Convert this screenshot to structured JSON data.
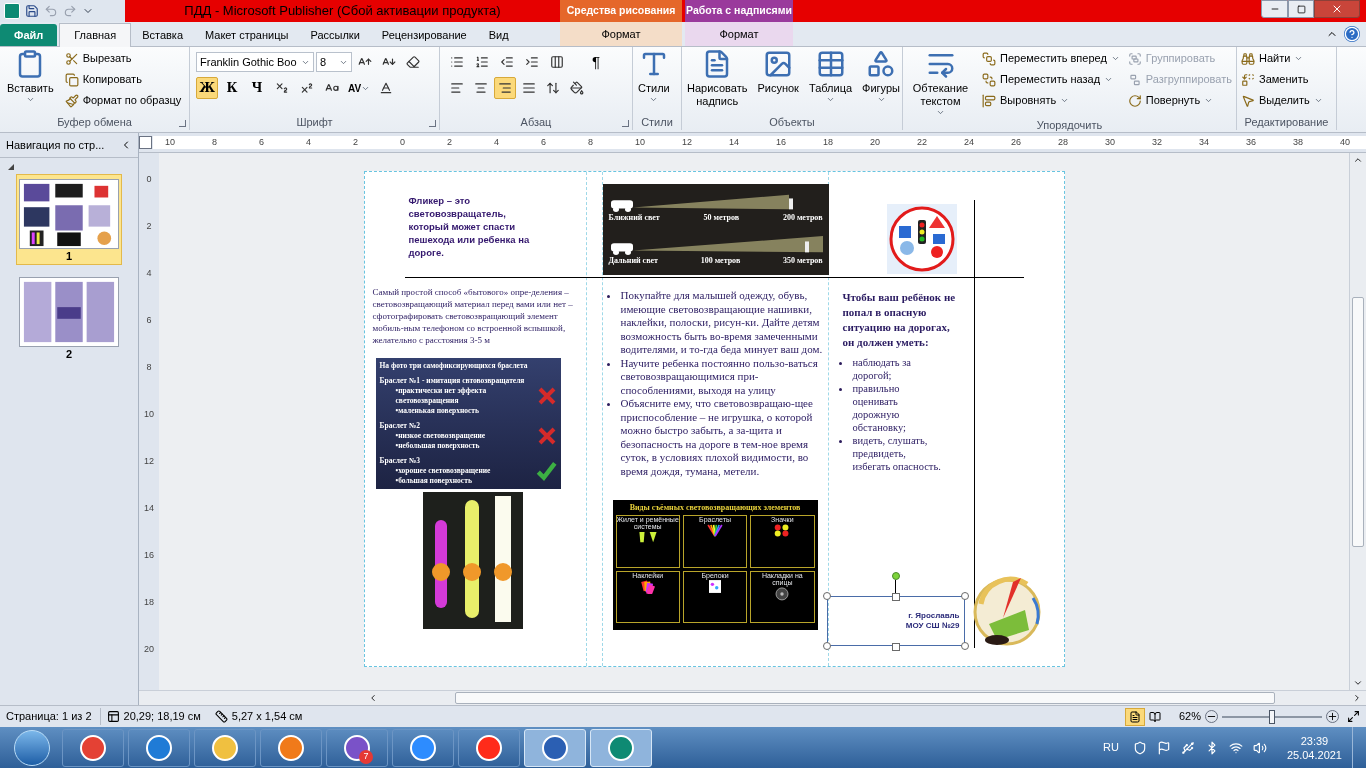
{
  "window": {
    "title": "ПДД  -  Microsoft Publisher (Сбой активации продукта)"
  },
  "contextual": [
    {
      "group": "Средства рисования",
      "tab": "Формат",
      "color": "#e5672a"
    },
    {
      "group": "Работа с надписями",
      "tab": "Формат",
      "color": "#9a3a9c"
    }
  ],
  "tabs": [
    {
      "label": "Файл",
      "kind": "file",
      "selected": false
    },
    {
      "label": "Главная",
      "kind": "normal",
      "selected": true
    },
    {
      "label": "Вставка",
      "kind": "normal",
      "selected": false
    },
    {
      "label": "Макет страницы",
      "kind": "normal",
      "selected": false
    },
    {
      "label": "Рассылки",
      "kind": "normal",
      "selected": false
    },
    {
      "label": "Рецензирование",
      "kind": "normal",
      "selected": false
    },
    {
      "label": "Вид",
      "kind": "normal",
      "selected": false
    }
  ],
  "ribbon": [
    {
      "kind": "clipboard",
      "label": "Буфер обмена",
      "launcher": true,
      "big": [
        {
          "label": "Вставить",
          "dropdown": true
        }
      ],
      "small": [
        {
          "label": "Вырезать",
          "dropdown": false,
          "disabled": false
        },
        {
          "label": "Копировать",
          "dropdown": false,
          "disabled": false
        },
        {
          "label": "Формат по образцу",
          "dropdown": false,
          "disabled": false
        }
      ]
    },
    {
      "kind": "font",
      "label": "Шрифт",
      "launcher": true,
      "font": "Franklin Gothic Boo",
      "size": "8",
      "format_buttons": [
        {
          "label": "Ж",
          "selected": true
        },
        {
          "label": "К",
          "selected": false
        },
        {
          "label": "Ч",
          "selected": false
        }
      ],
      "spacing": "AV"
    },
    {
      "kind": "paragraph",
      "label": "Абзац",
      "launcher": true,
      "pilcrow": "¶",
      "align_buttons": [
        {
          "selected": false
        },
        {
          "selected": false
        },
        {
          "selected": true
        },
        {
          "selected": false
        }
      ]
    },
    {
      "kind": "styles",
      "label": "Стили",
      "big": [
        {
          "label": "Стили",
          "dropdown": true
        }
      ]
    },
    {
      "kind": "objects",
      "label": "Объекты",
      "big": [
        {
          "label": "Нарисовать надпись",
          "dropdown": false
        },
        {
          "label": "Рисунок",
          "dropdown": false
        },
        {
          "label": "Таблица",
          "dropdown": true
        },
        {
          "label": "Фигуры",
          "dropdown": true
        }
      ]
    },
    {
      "kind": "arrange",
      "label": "Упорядочить",
      "big": [
        {
          "label": "Обтекание текстом",
          "dropdown": true
        }
      ],
      "small": [
        {
          "label": "Переместить вперед",
          "dropdown": true,
          "disabled": false
        },
        {
          "label": "Переместить назад",
          "dropdown": true,
          "disabled": false
        },
        {
          "label": "Выровнять",
          "dropdown": true,
          "disabled": false
        },
        {
          "label": "Группировать",
          "dropdown": false,
          "disabled": true
        },
        {
          "label": "Разгруппировать",
          "dropdown": false,
          "disabled": true
        },
        {
          "label": "Повернуть",
          "dropdown": true,
          "disabled": false
        }
      ]
    },
    {
      "kind": "editing",
      "label": "Редактирование",
      "small": [
        {
          "label": "Найти",
          "dropdown": true,
          "disabled": false
        },
        {
          "label": "Заменить",
          "dropdown": false,
          "disabled": false
        },
        {
          "label": "Выделить",
          "dropdown": true,
          "disabled": false
        }
      ]
    }
  ],
  "navigation": {
    "title": "Навигация по стр...",
    "pages": [
      {
        "number": "1",
        "selected": true
      },
      {
        "number": "2",
        "selected": false
      }
    ]
  },
  "rulers": {
    "horizontal": [
      "10",
      "8",
      "6",
      "4",
      "2",
      "0",
      "2",
      "4",
      "6",
      "8",
      "10",
      "12",
      "14",
      "16",
      "18",
      "20",
      "22",
      "24",
      "26",
      "28",
      "30",
      "32",
      "34",
      "36",
      "38",
      "40"
    ],
    "vertical": [
      "0",
      "2",
      "4",
      "6",
      "8",
      "10",
      "12",
      "14",
      "16",
      "18",
      "20"
    ]
  },
  "document": {
    "left": {
      "title": "Фликер  – это световозвращатель, который может спасти пешехода  или ребенка на дороге.",
      "paragraph": "Самый простой способ «бытового» опре-деления –   световозвращающий материал перед вами или нет – сфотографировать световозвращающий  элемент мобиль-ным телефоном со встроенной вспышкой, желательно с расстояния 3-5 м",
      "slide": {
        "title": "На фото три самофиксирующихся браслета",
        "items": [
          {
            "heading": "Браслет №1 - имитация свтовозвращателя",
            "points": [
              "•практически нет эффекта световозвращения",
              "•маленькая поверхность"
            ],
            "good": false
          },
          {
            "heading": "Браслет №2",
            "points": [
              "•низкое световозвращение",
              "•небольшая поверхность"
            ],
            "good": false
          },
          {
            "heading": "Браслет №3",
            "points": [
              "•хорошее световозвращение",
              "•большая поверхность"
            ],
            "good": true
          }
        ]
      }
    },
    "middle": {
      "diagram": {
        "rows": [
          {
            "label": "Ближний свет",
            "near": "50 метров",
            "far": "200 метров"
          },
          {
            "label": "Дальний свет",
            "near": "100 метров",
            "far": "350 метров"
          }
        ]
      },
      "bullets": [
        "Покупайте для малышей одежду, обувь, имеющие световозвращающие нашивки, наклейки, полоски, рисун-ки. Дайте детям возможность быть во-время замеченными водителями, и то-гда беда минует ваш дом.",
        "Научите ребенка постоянно пользо-ваться световозвращающимися при-способлениями, выходя на улицу",
        "Объясните ему, что световозвращаю-щее приспособление – не игрушка, о которой можно быстро забыть, а за-щита и безопасность на дороге в тем-ное время суток, в условиях плохой видимости, во время дождя, тумана, метели."
      ],
      "types": {
        "title": "Виды съёмных световозвращающих элементов",
        "cells": [
          "Жилет и ремённые системы",
          "Браслеты",
          "Значки",
          "Наклейки",
          "Брелоки",
          "Накладки на спицы"
        ]
      }
    },
    "right": {
      "heading": "Чтобы ваш ребёнок не попал в  опасную ситуацию на дорогах, он должен уметь:",
      "bullets": [
        " наблюдать за дорогой;",
        "правильно оценивать дорожную обстановку;",
        "видеть, слушать, предвидеть, избегать опасность."
      ],
      "signature": [
        "г. Ярославль",
        "МОУ СШ №29"
      ]
    }
  },
  "status_bar": {
    "page": "Страница: 1 из 2",
    "position": "20,29; 18,19 см",
    "size": "5,27 x  1,54 см",
    "views": [
      {
        "selected": true
      },
      {
        "selected": false
      }
    ],
    "zoom": "62%",
    "zoom_slider": {
      "level": 0.5
    }
  },
  "taskbar": {
    "viber_badge": "7",
    "language": "RU",
    "time": "23:39",
    "date": "25.04.2021"
  }
}
